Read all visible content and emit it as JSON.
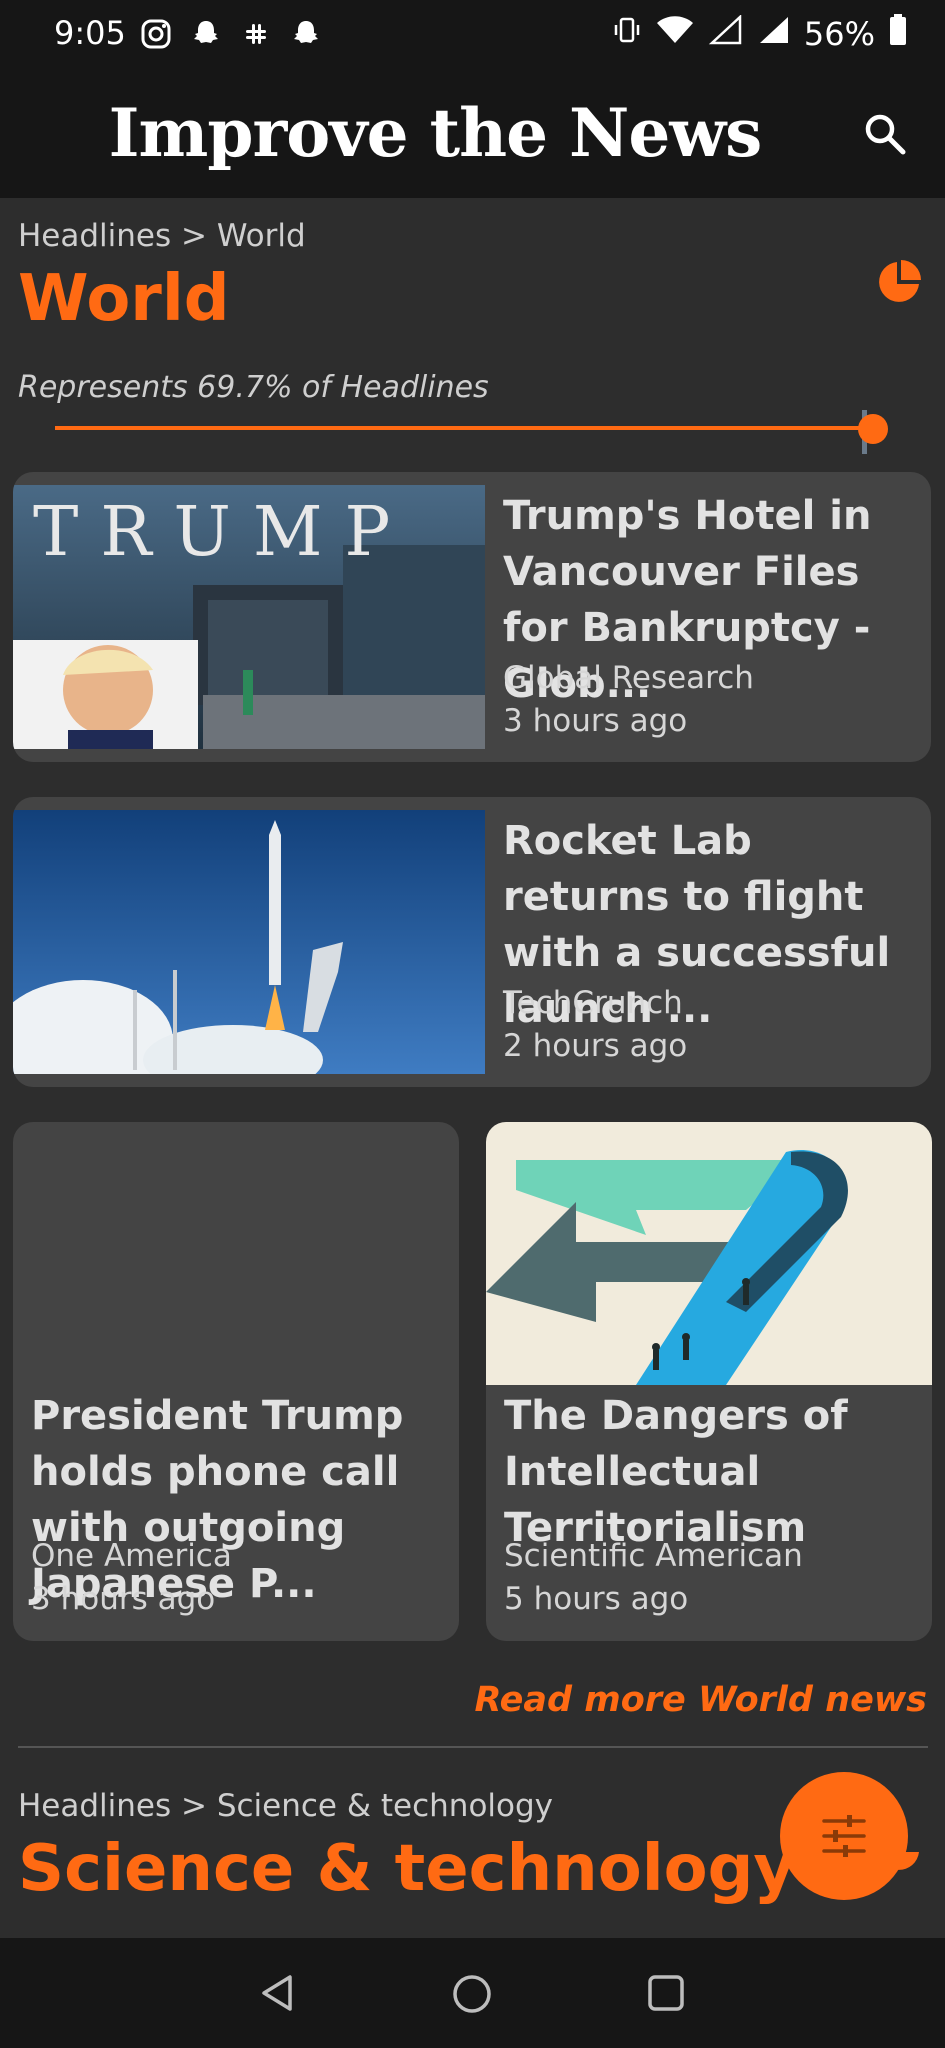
{
  "status_bar": {
    "time": "9:05",
    "battery": "56%"
  },
  "app": {
    "title": "Improve the News"
  },
  "world": {
    "breadcrumb": "Headlines > World",
    "title": "World",
    "represents": "Represents 69.7% of Headlines",
    "slider_fraction": 0.97,
    "read_more": "Read more World news"
  },
  "articles": [
    {
      "headline": "Trump's Hotel in Vancouver Files for Bankruptcy - Glob...",
      "source": "Global Research",
      "time": "3 hours ago"
    },
    {
      "headline": "Rocket Lab returns to flight with a successful launch ...",
      "source": "TechCrunch",
      "time": "2 hours ago"
    },
    {
      "headline": "President Trump holds phone call with outgoing Japanese P...",
      "source": "One America",
      "time": "3 hours ago"
    },
    {
      "headline": "The Dangers of Intellectual Territorialism",
      "source": "Scientific American",
      "time": "5 hours ago"
    }
  ],
  "science": {
    "breadcrumb": "Headlines > Science & technology",
    "title": "Science & technology"
  },
  "colors": {
    "accent": "#ff6a13",
    "background": "#2d2d2d",
    "card": "#444444",
    "bar": "#161616"
  },
  "icons": [
    "instagram-icon",
    "snapchat-icon",
    "slack-icon",
    "vibrate-icon",
    "wifi-icon",
    "signal-icon",
    "battery-icon",
    "search-icon",
    "pie-chart-icon",
    "filter-sliders-icon",
    "back-icon",
    "home-icon",
    "recents-icon"
  ]
}
